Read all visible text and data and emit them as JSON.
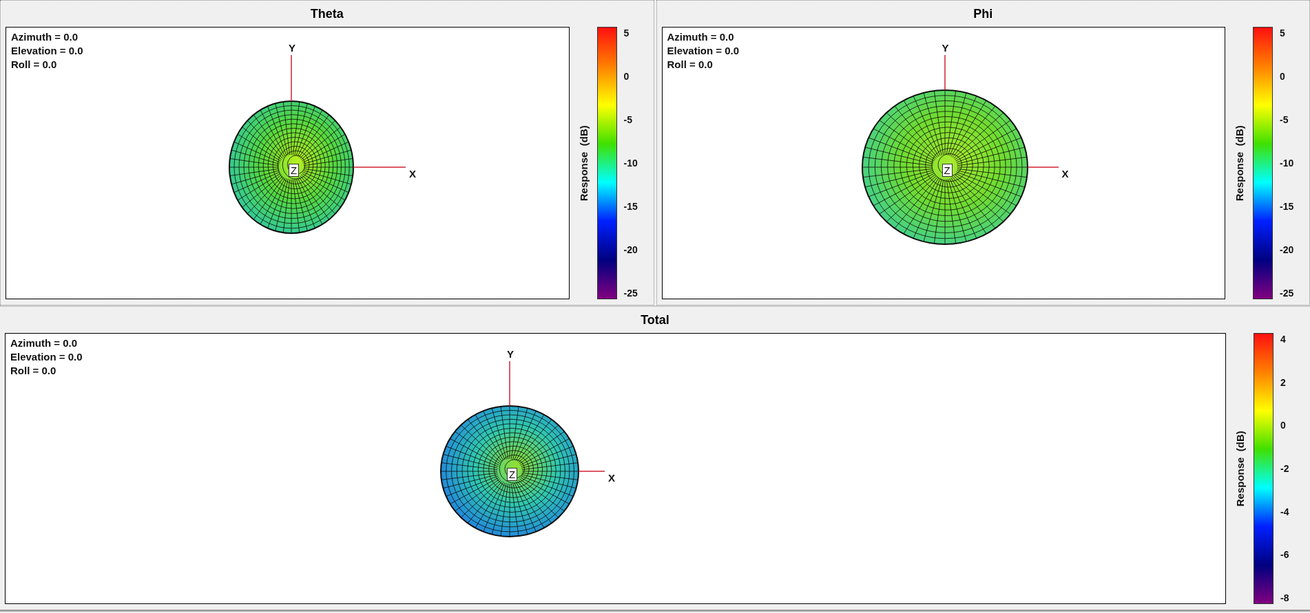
{
  "panels": [
    {
      "title": "Theta",
      "view": [
        "Azimuth = 0.0",
        "Elevation = 0.0",
        "Roll = 0.0"
      ],
      "axes": {
        "x": "X",
        "y": "Y",
        "z": "Z"
      },
      "colorbar": {
        "label": "Response  (dB)",
        "ticks": [
          "5",
          "0",
          "-5",
          "-10",
          "-15",
          "-20",
          "-25"
        ]
      }
    },
    {
      "title": "Phi",
      "view": [
        "Azimuth = 0.0",
        "Elevation = 0.0",
        "Roll = 0.0"
      ],
      "axes": {
        "x": "X",
        "y": "Y",
        "z": "Z"
      },
      "colorbar": {
        "label": "Response  (dB)",
        "ticks": [
          "5",
          "0",
          "-5",
          "-10",
          "-15",
          "-20",
          "-25"
        ]
      }
    },
    {
      "title": "Total",
      "view": [
        "Azimuth = 0.0",
        "Elevation = 0.0",
        "Roll = 0.0"
      ],
      "axes": {
        "x": "X",
        "y": "Y",
        "z": "Z"
      },
      "colorbar": {
        "label": "Response  (dB)",
        "ticks": [
          "4",
          "2",
          "0",
          "-2",
          "-4",
          "-6",
          "-8"
        ]
      }
    }
  ]
}
